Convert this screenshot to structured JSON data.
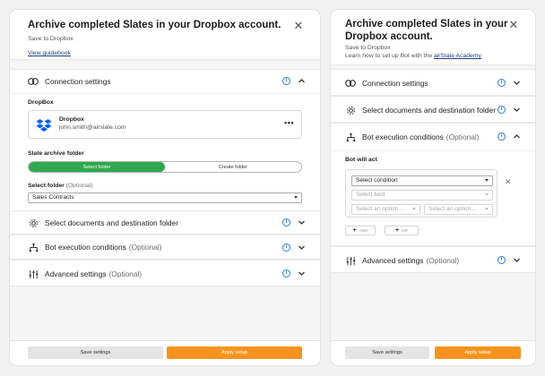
{
  "colors": {
    "accent_green": "#2fa84f",
    "accent_orange": "#f7931e",
    "info_blue": "#2a7de1",
    "link_blue": "#1d3d7c"
  },
  "panel_a": {
    "title": "Archive completed Slates in your Dropbox account.",
    "subtitle": "Save to Dropbox",
    "link": "View guidebook",
    "close_icon": "close-icon",
    "sections": {
      "connection": {
        "title": "Connection settings",
        "icon": "link-icon"
      },
      "documents": {
        "title": "Select documents and destination folder",
        "icon": "gear-icon"
      },
      "execution": {
        "title": "Bot execution conditions",
        "optional": "(Optional)",
        "icon": "branch-icon"
      },
      "advanced": {
        "title": "Advanced settings",
        "optional": "(Optional)",
        "icon": "sliders-icon"
      }
    },
    "connection": {
      "label": "DropBox",
      "account_name": "Dropbox",
      "account_email": "john.smith@airslate.com",
      "more_icon": "more-dots-icon",
      "archive_label": "Slate archive folder",
      "toggle_select": "Select folder",
      "toggle_create": "Create folder",
      "select_label": "Select folder",
      "select_optional": "(Optional)",
      "select_value": "Sales Contracts"
    },
    "footer": {
      "save": "Save settings",
      "apply": "Apply setup"
    }
  },
  "panel_b": {
    "title_line1": "Archive completed Slates in your",
    "title_line2": "Dropbox account.",
    "subtitle": "Save to Dropbox",
    "learn_text": "Learn how to set up Bot with the ",
    "learn_link": "airSlate Academy",
    "close_icon": "close-icon",
    "sections": {
      "connection": {
        "title": "Connection settings"
      },
      "documents": {
        "title": "Select documents and destination folder"
      },
      "execution": {
        "title": "Bot execution conditions",
        "optional": "(Optional)"
      },
      "advanced": {
        "title": "Advanced settings",
        "optional": "(Optional)"
      }
    },
    "conditions": {
      "label": "Bot will act",
      "select_condition": "Select condition",
      "select_field": "Select field",
      "option_1": "Select an option...",
      "option_2": "Select an option...",
      "and_label": "AND",
      "or_label": "OR"
    },
    "footer": {
      "save": "Save settings",
      "apply": "Apply setup"
    }
  }
}
